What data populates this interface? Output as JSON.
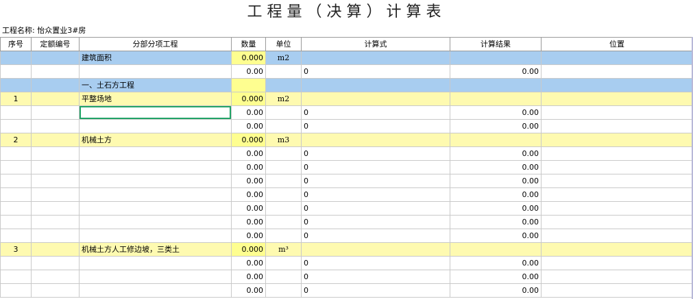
{
  "title": "工程量（决算）计算表",
  "project_label": "工程名称: 怡众置业3#房",
  "headers": [
    "序号",
    "定额编号",
    "分部分项工程",
    "数量",
    "单位",
    "计算式",
    "计算结果",
    "位置"
  ],
  "colors": {
    "section_blue": "#a8cdf0",
    "item_yellow": "#fefab0",
    "selection": "#21a366"
  },
  "rows": [
    {
      "style": "blue",
      "seq": "",
      "code": "",
      "name": "建筑面积",
      "qty": "0.000",
      "unit": "m2",
      "formula": "",
      "result": "",
      "pos": ""
    },
    {
      "style": "",
      "seq": "",
      "code": "",
      "name": "",
      "qty": "0.00",
      "unit": "",
      "formula": "0",
      "result": "0.00",
      "pos": ""
    },
    {
      "style": "blue",
      "seq": "",
      "code": "",
      "name": "一、土石方工程",
      "qty": "",
      "unit": "",
      "formula": "",
      "result": "",
      "pos": ""
    },
    {
      "style": "yellow",
      "seq": "1",
      "code": "",
      "name": "平整场地",
      "qty": "0.000",
      "unit": "m2",
      "formula": "",
      "result": "",
      "pos": ""
    },
    {
      "style": "",
      "seq": "",
      "code": "",
      "name": "",
      "qty": "0.00",
      "unit": "",
      "formula": "0",
      "result": "0.00",
      "pos": "",
      "selected": true
    },
    {
      "style": "",
      "seq": "",
      "code": "",
      "name": "",
      "qty": "0.00",
      "unit": "",
      "formula": "0",
      "result": "0.00",
      "pos": ""
    },
    {
      "style": "yellow",
      "seq": "2",
      "code": "",
      "name": "机械土方",
      "qty": "0.000",
      "unit": "m3",
      "formula": "",
      "result": "",
      "pos": ""
    },
    {
      "style": "",
      "seq": "",
      "code": "",
      "name": "",
      "qty": "0.00",
      "unit": "",
      "formula": "0",
      "result": "0.00",
      "pos": ""
    },
    {
      "style": "",
      "seq": "",
      "code": "",
      "name": "",
      "qty": "0.00",
      "unit": "",
      "formula": "0",
      "result": "0.00",
      "pos": ""
    },
    {
      "style": "",
      "seq": "",
      "code": "",
      "name": "",
      "qty": "0.00",
      "unit": "",
      "formula": "0",
      "result": "0.00",
      "pos": ""
    },
    {
      "style": "",
      "seq": "",
      "code": "",
      "name": "",
      "qty": "0.00",
      "unit": "",
      "formula": "0",
      "result": "0.00",
      "pos": ""
    },
    {
      "style": "",
      "seq": "",
      "code": "",
      "name": "",
      "qty": "0.00",
      "unit": "",
      "formula": "0",
      "result": "0.00",
      "pos": ""
    },
    {
      "style": "",
      "seq": "",
      "code": "",
      "name": "",
      "qty": "0.00",
      "unit": "",
      "formula": "0",
      "result": "0.00",
      "pos": ""
    },
    {
      "style": "",
      "seq": "",
      "code": "",
      "name": "",
      "qty": "0.00",
      "unit": "",
      "formula": "0",
      "result": "0.00",
      "pos": ""
    },
    {
      "style": "yellow",
      "seq": "3",
      "code": "",
      "name": "机械土方人工修边坡，三类土",
      "qty": "0.000",
      "unit": "m³",
      "formula": "",
      "result": "",
      "pos": ""
    },
    {
      "style": "",
      "seq": "",
      "code": "",
      "name": "",
      "qty": "0.00",
      "unit": "",
      "formula": "0",
      "result": "0.00",
      "pos": ""
    },
    {
      "style": "",
      "seq": "",
      "code": "",
      "name": "",
      "qty": "0.00",
      "unit": "",
      "formula": "0",
      "result": "0.00",
      "pos": ""
    },
    {
      "style": "",
      "seq": "",
      "code": "",
      "name": "",
      "qty": "0.00",
      "unit": "",
      "formula": "0",
      "result": "0.00",
      "pos": ""
    }
  ]
}
